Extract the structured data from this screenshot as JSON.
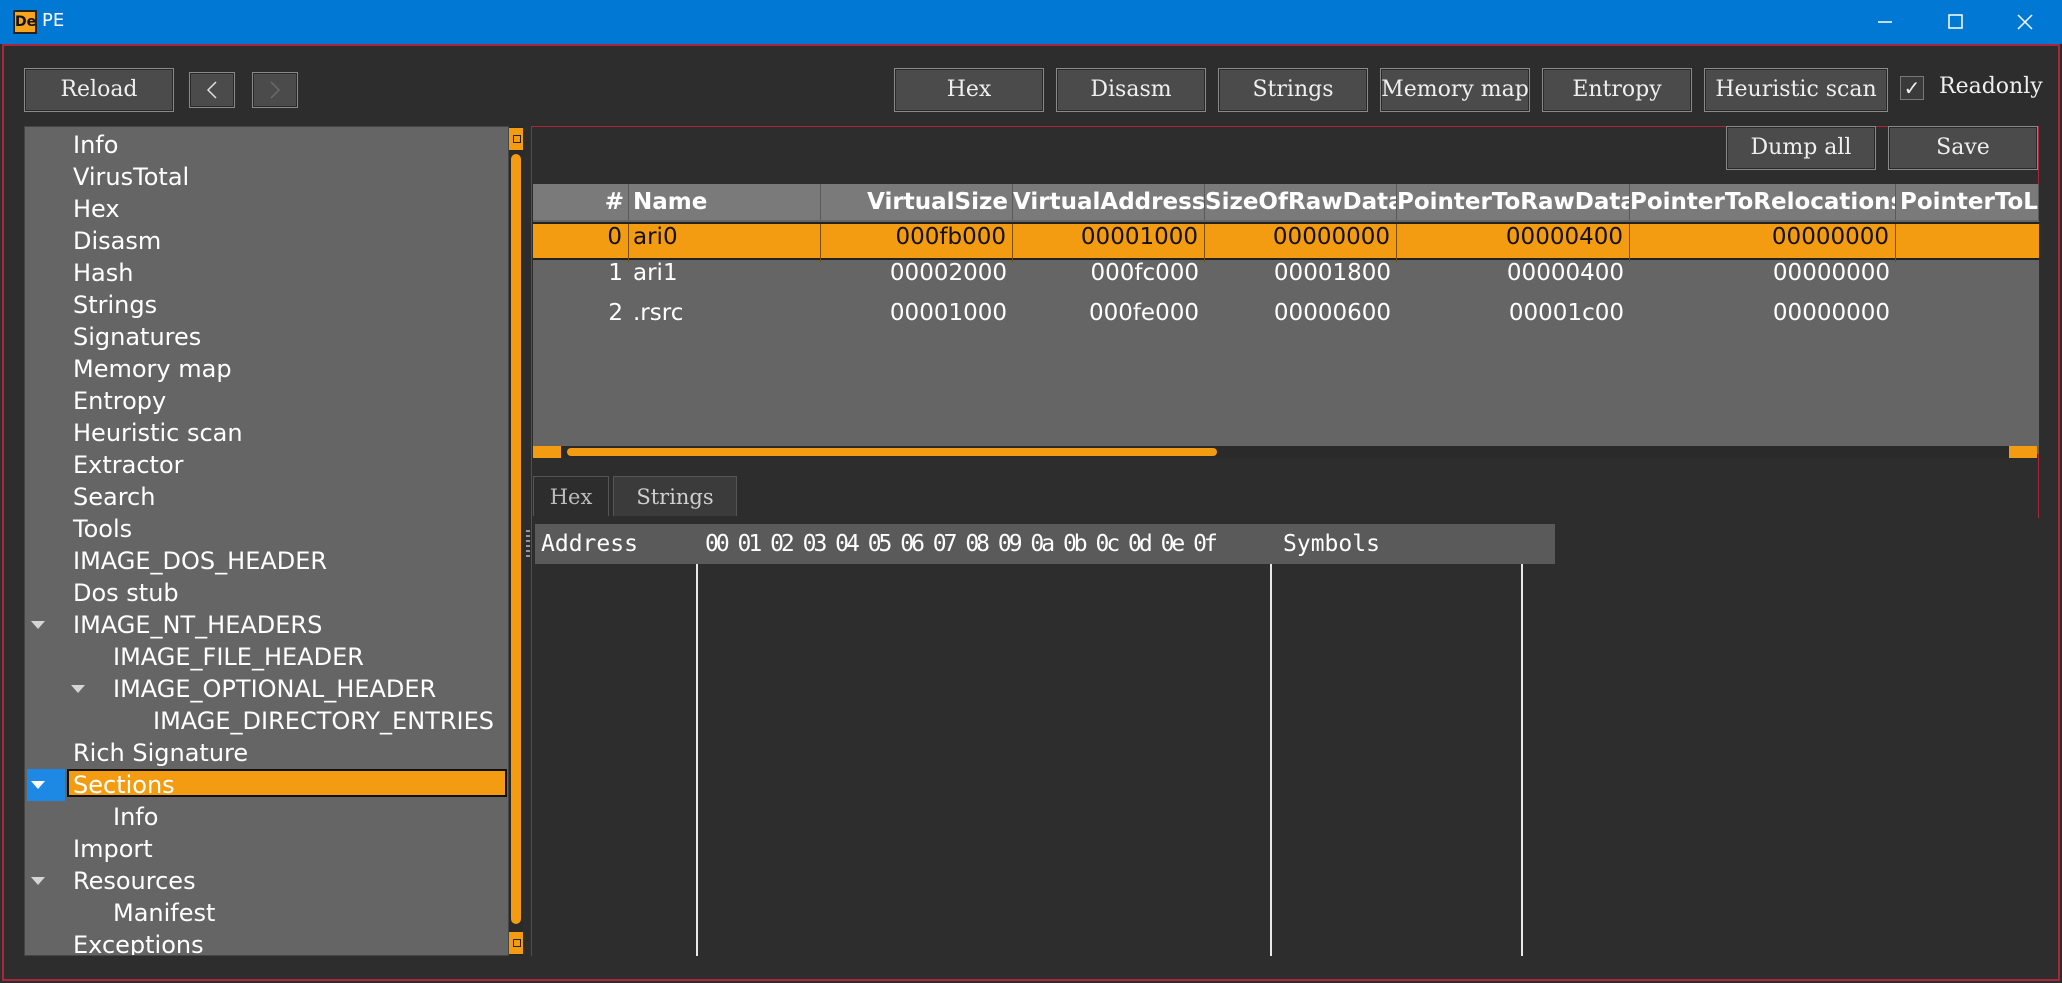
{
  "window": {
    "title": "PE",
    "icon_text": "De",
    "icon_name": "detect-it-easy-icon"
  },
  "toolbar": {
    "reload": "Reload",
    "back": "<",
    "forward": ">",
    "hex": "Hex",
    "disasm": "Disasm",
    "strings": "Strings",
    "memory_map": "Memory map",
    "entropy": "Entropy",
    "heuristic_scan": "Heuristic scan",
    "readonly": "Readonly",
    "readonly_checked": "✓"
  },
  "tree": {
    "items": [
      {
        "label": "Info"
      },
      {
        "label": "VirusTotal"
      },
      {
        "label": "Hex"
      },
      {
        "label": "Disasm"
      },
      {
        "label": "Hash"
      },
      {
        "label": "Strings"
      },
      {
        "label": "Signatures"
      },
      {
        "label": "Memory map"
      },
      {
        "label": "Entropy"
      },
      {
        "label": "Heuristic scan"
      },
      {
        "label": "Extractor"
      },
      {
        "label": "Search"
      },
      {
        "label": "Tools"
      },
      {
        "label": "IMAGE_DOS_HEADER"
      },
      {
        "label": "Dos stub"
      },
      {
        "label": "IMAGE_NT_HEADERS"
      },
      {
        "label": "IMAGE_FILE_HEADER"
      },
      {
        "label": "IMAGE_OPTIONAL_HEADER"
      },
      {
        "label": "IMAGE_DIRECTORY_ENTRIES"
      },
      {
        "label": "Rich Signature"
      },
      {
        "label": "Sections"
      },
      {
        "label": "Info"
      },
      {
        "label": "Import"
      },
      {
        "label": "Resources"
      },
      {
        "label": "Manifest"
      },
      {
        "label": "Exceptions"
      }
    ]
  },
  "actions": {
    "dump_all": "Dump all",
    "save": "Save"
  },
  "sections_table": {
    "columns": [
      "#",
      "Name",
      "VirtualSize",
      "VirtualAddress",
      "SizeOfRawData",
      "PointerToRawData",
      "PointerToRelocations",
      "PointerToLi"
    ],
    "rows": [
      [
        "0",
        "ari0",
        "000fb000",
        "00001000",
        "00000000",
        "00000400",
        "00000000"
      ],
      [
        "1",
        "ari1",
        "00002000",
        "000fc000",
        "00001800",
        "00000400",
        "00000000"
      ],
      [
        "2",
        ".rsrc",
        "00001000",
        "000fe000",
        "00000600",
        "00001c00",
        "00000000"
      ]
    ]
  },
  "bottom_tabs": {
    "hex": "Hex",
    "strings": "Strings"
  },
  "hex_view": {
    "address_header": "Address",
    "bytes_header": "00 01 02 03 04 05 06 07 08 09 0a 0b 0c 0d 0e 0f",
    "symbols_header": "Symbols"
  }
}
